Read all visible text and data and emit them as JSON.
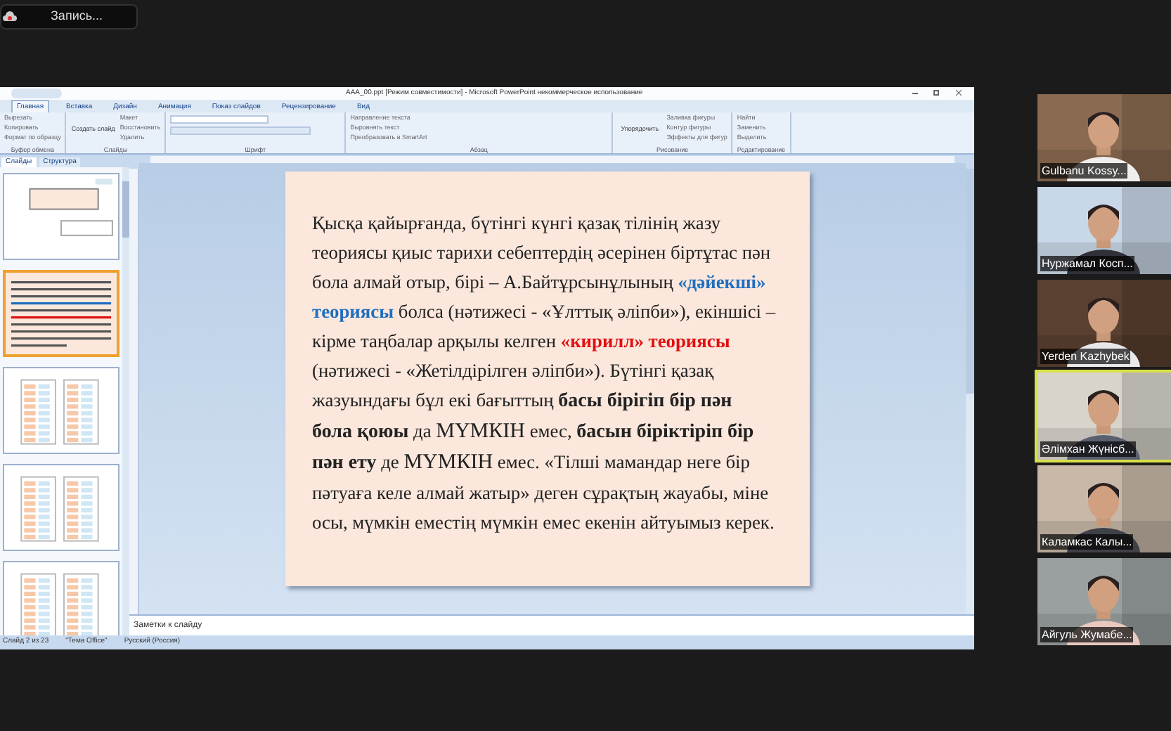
{
  "recording": {
    "label": "Запись..."
  },
  "window": {
    "title": "AAA_00.ppt [Режим совместимости] - Microsoft PowerPoint некоммерческое использование"
  },
  "ribbon_tabs": [
    {
      "label": "Главная",
      "selected": true
    },
    {
      "label": "Вставка",
      "selected": false
    },
    {
      "label": "Дизайн",
      "selected": false
    },
    {
      "label": "Анимация",
      "selected": false
    },
    {
      "label": "Показ слайдов",
      "selected": false
    },
    {
      "label": "Рецензирование",
      "selected": false
    },
    {
      "label": "Вид",
      "selected": false
    }
  ],
  "ribbon_groups": [
    {
      "label": "Буфер обмена",
      "items": [
        "Вырезать",
        "Копировать",
        "Формат по образцу"
      ]
    },
    {
      "label": "Слайды",
      "big": "Создать слайд",
      "items": [
        "Макет",
        "Восстановить",
        "Удалить"
      ]
    },
    {
      "label": "Шрифт"
    },
    {
      "label": "Абзац",
      "items": [
        "Направление текста",
        "Выровнять текст",
        "Преобразовать в SmartArt"
      ]
    },
    {
      "label": "Рисование",
      "big": "Упорядочить",
      "items": [
        "Заливка фигуры",
        "Контур фигуры",
        "Эффекты для фигур"
      ]
    },
    {
      "label": "Редактирование",
      "items": [
        "Найти",
        "Заменить",
        "Выделить"
      ]
    }
  ],
  "pane_tabs": [
    {
      "label": "Слайды",
      "selected": true
    },
    {
      "label": "Структура",
      "selected": false
    }
  ],
  "thumbnails": [
    {
      "kind": "title",
      "selected": false
    },
    {
      "kind": "text",
      "selected": true
    },
    {
      "kind": "table",
      "selected": false
    },
    {
      "kind": "table",
      "selected": false
    },
    {
      "kind": "table",
      "selected": false
    }
  ],
  "slide": {
    "segments": [
      {
        "kind": "normal",
        "text": "Қысқа қайырғанда, бүтінгі күнгі қазақ тілінің жазу теориясы қиыс тарихи себептердің әсерінен біртұтас пән бола алмай отыр, бірі – А.Байтұрсынұлының "
      },
      {
        "kind": "blue",
        "text": "«дәйекші» теориясы"
      },
      {
        "kind": "normal",
        "text": " болса (нәтижесі - «Ұлттық әліпби»), екіншісі – кірме таңбалар арқылы келген "
      },
      {
        "kind": "red",
        "text": "«кирилл» теориясы"
      },
      {
        "kind": "normal",
        "text": " (нәтижесі - «Жетілдірілген әліпби»). Бүтінгі қазақ жазуындағы бұл екі бағыттың "
      },
      {
        "kind": "bold",
        "text": "басы бірігіп бір пән бола қоюы"
      },
      {
        "kind": "normal",
        "text": " да "
      },
      {
        "kind": "big",
        "text": "МҮМКІН"
      },
      {
        "kind": "normal",
        "text": " емес, "
      },
      {
        "kind": "bold",
        "text": "басын біріктіріп бір пән ету"
      },
      {
        "kind": "normal",
        "text": " де "
      },
      {
        "kind": "big",
        "text": "МҮМКІН"
      },
      {
        "kind": "normal",
        "text": " емес. «Тілші мамандар неге бір пәтуаға келе алмай жатыр» деген сұрақтың жауабы, міне осы, мүмкін еместің мүмкін емес екенін айтуымыз керек."
      }
    ]
  },
  "notes": {
    "placeholder": "Заметки к слайду"
  },
  "status_bar": [
    "Слайд 2 из 23",
    "\"Тема Office\"",
    "Русский (Россия)"
  ],
  "participants": [
    {
      "name": "Gulbanu Kossy...",
      "selected": false
    },
    {
      "name": "Нуржамал Косп...",
      "selected": false
    },
    {
      "name": "Yerden Kazhybek",
      "selected": false
    },
    {
      "name": "Әлімхан Жүнісб...",
      "selected": true
    },
    {
      "name": "Каламкас Калы...",
      "selected": false
    },
    {
      "name": "Айгуль Жумабе...",
      "selected": false
    }
  ]
}
